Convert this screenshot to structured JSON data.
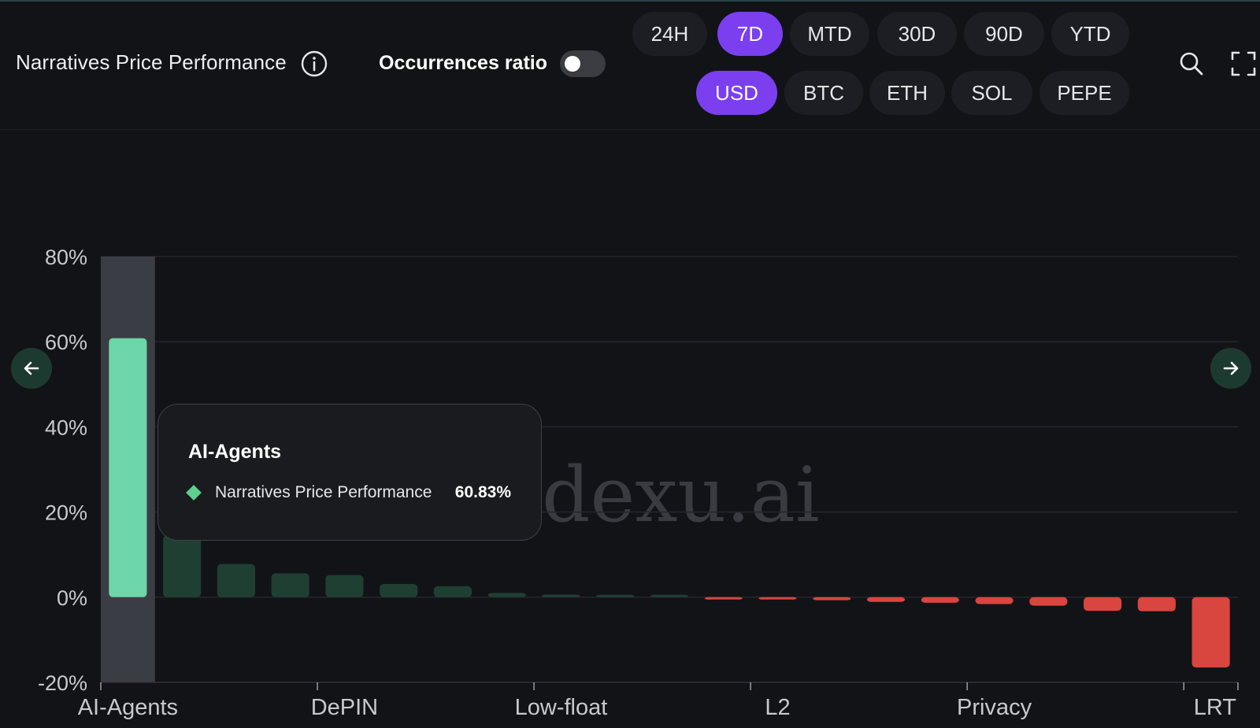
{
  "header": {
    "title": "Narratives Price Performance",
    "occurrences_label": "Occurrences ratio",
    "occurrences_enabled": false,
    "timeframes": [
      "24H",
      "7D",
      "MTD",
      "30D",
      "90D",
      "YTD"
    ],
    "active_timeframe": "7D",
    "currencies": [
      "USD",
      "BTC",
      "ETH",
      "SOL",
      "PEPE"
    ],
    "active_currency": "USD"
  },
  "icons": {
    "info": "info-icon",
    "search": "search-icon",
    "fullscreen": "fullscreen-icon",
    "prev": "arrow-left-icon",
    "next": "arrow-right-icon"
  },
  "watermark": "dexu.ai",
  "tooltip": {
    "title": "AI-Agents",
    "series": "Narratives Price Performance",
    "value": "60.83%"
  },
  "colors": {
    "accent": "#7b3ff0",
    "positive_highlight": "#6dd6a8",
    "positive": "#1f3f33",
    "negative": "#d9453f",
    "background": "#121317",
    "hover_band": "#3b3d44"
  },
  "chart_data": {
    "type": "bar",
    "series_name": "Narratives Price Performance",
    "xlabels": [
      "AI-Agents",
      "DePIN",
      "Low-float",
      "L2",
      "Privacy",
      "LRT"
    ],
    "ylim": [
      -20,
      80
    ],
    "yticks": [
      -20,
      0,
      20,
      40,
      60,
      80
    ],
    "ytick_labels": [
      "-20%",
      "0%",
      "20%",
      "40%",
      "60%",
      "80%"
    ],
    "grid": true,
    "highlighted_index": 0,
    "values": [
      60.83,
      14.5,
      7.8,
      5.6,
      5.2,
      3.1,
      2.6,
      1.0,
      0.6,
      0.4,
      0.2,
      -0.3,
      -0.4,
      -0.7,
      -1.1,
      -1.3,
      -1.6,
      -2.0,
      -3.2,
      -3.3,
      -16.5
    ]
  }
}
